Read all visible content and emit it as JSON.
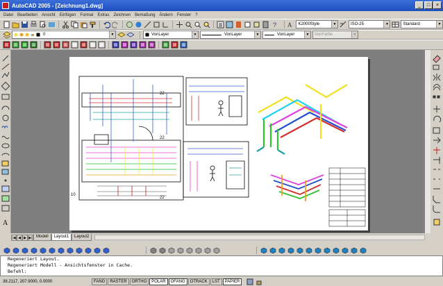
{
  "window": {
    "title": "AutoCAD 2005 - [Zeichnung1.dwg]"
  },
  "menu": [
    "Datei",
    "Bearbeiten",
    "Ansicht",
    "Einfügen",
    "Format",
    "Extras",
    "Zeichnen",
    "Bemaßung",
    "Ändern",
    "Fenster",
    "?"
  ],
  "styles": {
    "text_style": "K2000Style",
    "dim_style": "ISO-25",
    "plot_style": "Standard"
  },
  "layer": {
    "current": "0"
  },
  "properties": {
    "color": "VonLayer",
    "linetype": "VonLayer",
    "lineweight": "VonLayer",
    "plotstyle": "VonFarbe"
  },
  "tabs": [
    "Modell",
    "Layout1",
    "Layout2"
  ],
  "active_tab": 1,
  "command_lines": [
    "Regeneriert Layout.",
    "Regeneriert Modell - Ansichtsfenster in Cache.",
    "Befehl:"
  ],
  "status": {
    "coords": "38.2117, 207.9000, 0.0000",
    "buttons": [
      "FANG",
      "RASTER",
      "ORTHO",
      "POLAR",
      "OFANG",
      "OTRACK",
      "LST",
      "PAPIER"
    ]
  },
  "drawing_labels": {
    "label_10": "10",
    "label_22_top": "22",
    "label_22_mid": "22",
    "label_22_bottom": "22",
    "label_10_bottom": "10"
  },
  "colors": {
    "canvas": "#7f7f7f",
    "title_bar": "#1f4fbf",
    "paper": "#ffffff"
  }
}
